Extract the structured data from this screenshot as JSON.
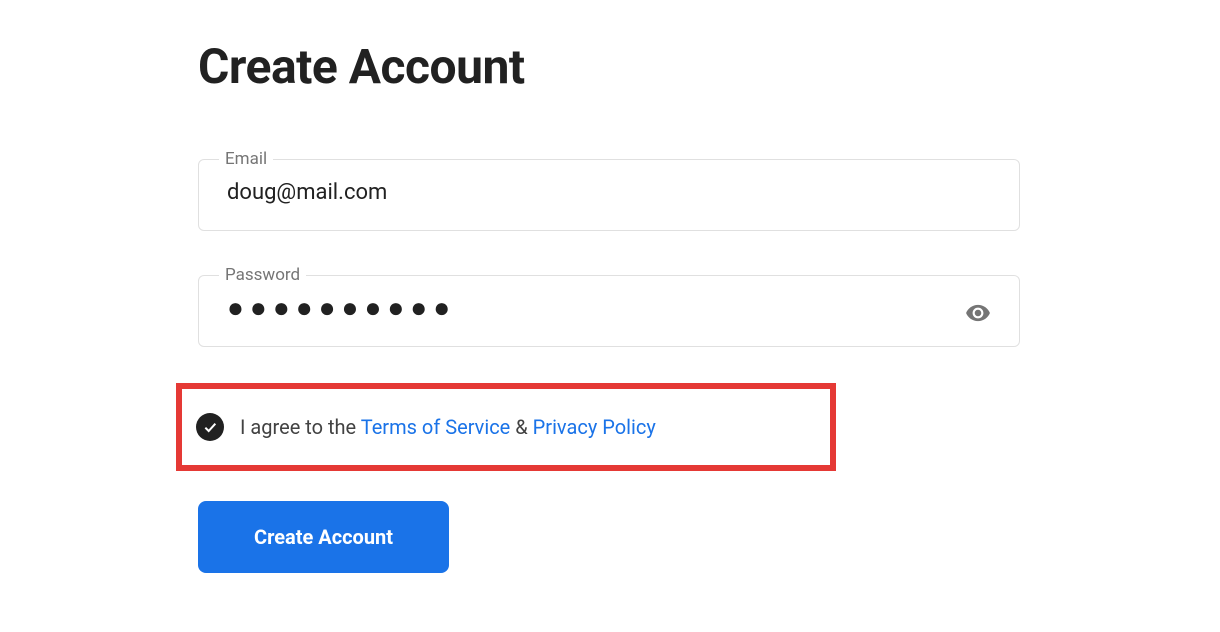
{
  "page": {
    "title": "Create Account"
  },
  "form": {
    "email": {
      "label": "Email",
      "value": "doug@mail.com"
    },
    "password": {
      "label": "Password",
      "masked_value": "●●●●●●●●●●"
    },
    "agree": {
      "checked": true,
      "prefix_text": "I agree to the ",
      "tos_label": "Terms of Service",
      "separator": " & ",
      "privacy_label": "Privacy Policy"
    },
    "submit_label": "Create Account"
  },
  "icons": {
    "eye": "eye-icon",
    "check": "check-icon"
  }
}
